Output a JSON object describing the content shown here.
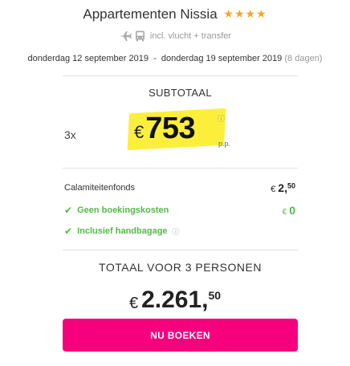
{
  "hotel": {
    "name": "Appartementen Nissia",
    "stars": "★★★★"
  },
  "includes": {
    "text": "incl. vlucht + transfer",
    "icons": [
      "plane-icon",
      "bus-icon"
    ]
  },
  "dates": {
    "range": "donderdag 12 september 2019  -  donderdag 19 september 2019",
    "duration": "(8 dagen)"
  },
  "subtotal": {
    "label": "SUBTOTAAL",
    "quantity": "3x",
    "currency": "€",
    "amount": "753",
    "info_icon": "ⓘ",
    "per_person": "p.p."
  },
  "costs": [
    {
      "label": "Calamiteitenfonds",
      "currency": "€",
      "int": "2,",
      "dec": "50"
    },
    {
      "label": "Geen boekingskosten",
      "currency": "€",
      "int": "0",
      "dec": ""
    },
    {
      "label": "Inclusief handbagage",
      "info": "ⓘ"
    }
  ],
  "total": {
    "label": "TOTAAL VOOR 3 PERSONEN",
    "currency": "€",
    "int": "2.261,",
    "dec": "50"
  },
  "cta": {
    "label": "NU BOEKEN"
  },
  "colors": {
    "accent": "#f7007e",
    "highlight": "#fbef3c",
    "success": "#55b848",
    "stars": "#f5a623"
  }
}
